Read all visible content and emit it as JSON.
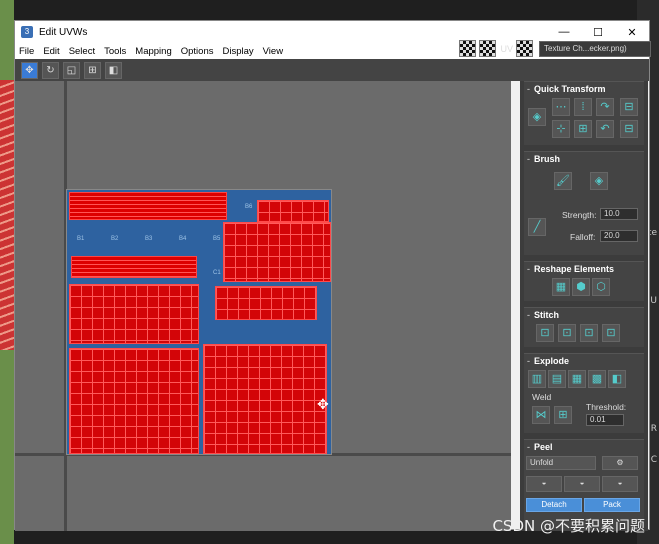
{
  "window": {
    "app_icon": "3",
    "title": "Edit UVWs",
    "minimize": "—",
    "maximize": "☐",
    "close": "✕"
  },
  "menu": [
    "File",
    "Edit",
    "Select",
    "Tools",
    "Mapping",
    "Options",
    "Display",
    "View"
  ],
  "toolbar": {
    "uv_label": "UV",
    "texture_dropdown": "Texture Ch...ecker.png)"
  },
  "grid_labels": [
    "B6",
    "B1",
    "B2",
    "B3",
    "B4",
    "B5",
    "C1"
  ],
  "panel": {
    "quick_transform": "Quick Transform",
    "brush": "Brush",
    "strength_label": "Strength:",
    "strength_value": "10.0",
    "falloff_label": "Falloff:",
    "falloff_value": "20.0",
    "reshape": "Reshape Elements",
    "stitch": "Stitch",
    "explode": "Explode",
    "weld_label": "Weld",
    "threshold_label": "Threshold:",
    "threshold_value": "0.01",
    "peel": "Peel",
    "unfold_value": "Unfold",
    "detach_label": "Detach",
    "pack_label": "Pack"
  },
  "background_right": [
    "te",
    "t U",
    "R",
    "C"
  ],
  "watermark": "CSDN @不要积累问题"
}
